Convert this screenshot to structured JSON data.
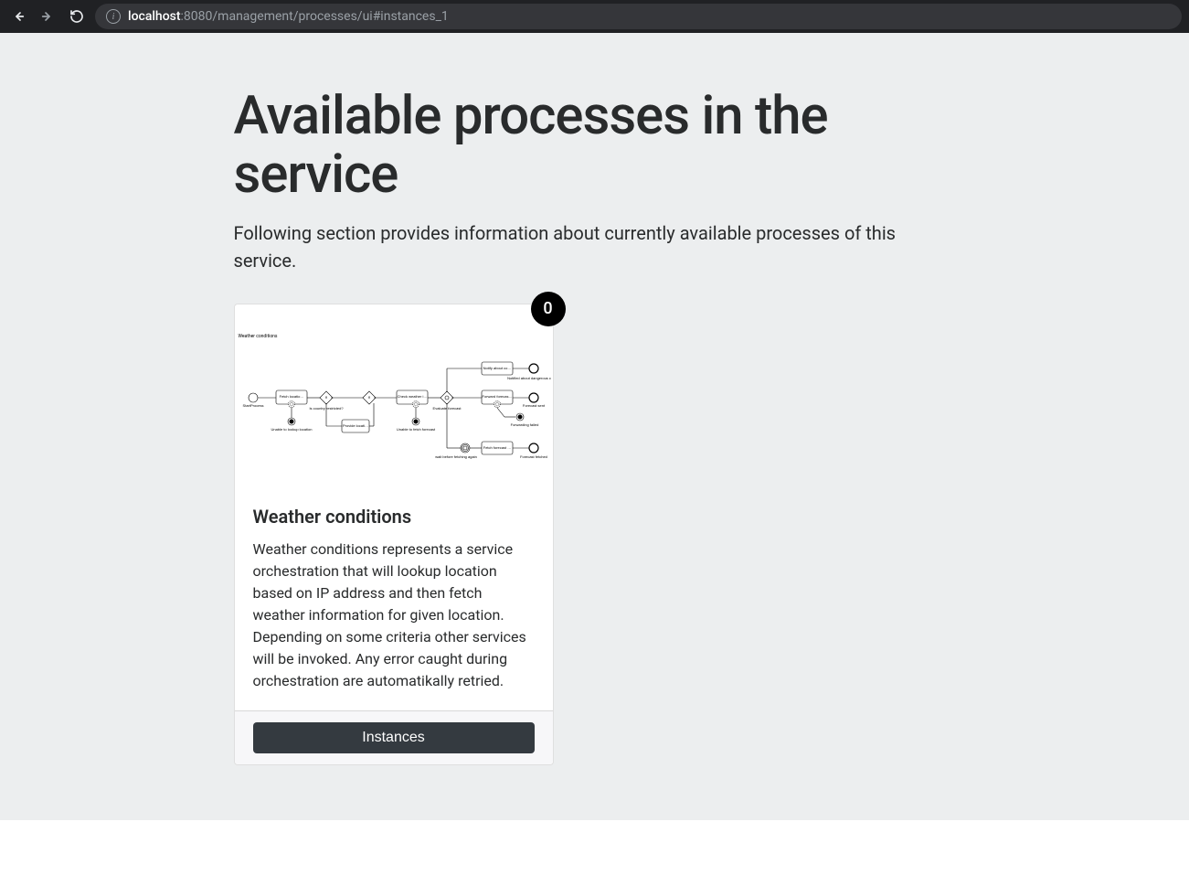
{
  "browser": {
    "url_host": "localhost",
    "url_rest": ":8080/management/processes/ui#instances_1"
  },
  "page": {
    "title": "Available processes in the service",
    "subtitle": "Following section provides information about currently available processes of this service."
  },
  "process_card": {
    "badge_count": "0",
    "diagram_label": "Weather conditions",
    "title": "Weather conditions",
    "description": "Weather conditions represents a service orchestration that will lookup location based on IP address and then fetch weather information for given location. Depending on some criteria other services will be invoked. Any error caught during orchestration are automatikally retried.",
    "instances_button": "Instances",
    "diagram_nodes": {
      "start": "StartProcess",
      "fetch_location": "Fetch locatio…",
      "gateway1": "Is country restricted?",
      "unable_lookup": "Unable to lookup location",
      "provide_loc": "Provide locati…",
      "check_weather": "Check weather i…",
      "unable_fetch": "Unable to fetch forecast",
      "evaluate": "Evaluate forecast",
      "notify": "Notify about co…",
      "notified": "Notified about dangerous c",
      "forward": "Forward forecas…",
      "forecast_sent": "Forecast sent",
      "forwarding_failed": "Forwarding failed",
      "wait": "wait before fetching again",
      "fetch_forecast": "Fetch forecast …",
      "forecast_fetched": "Forecast fetched"
    }
  }
}
